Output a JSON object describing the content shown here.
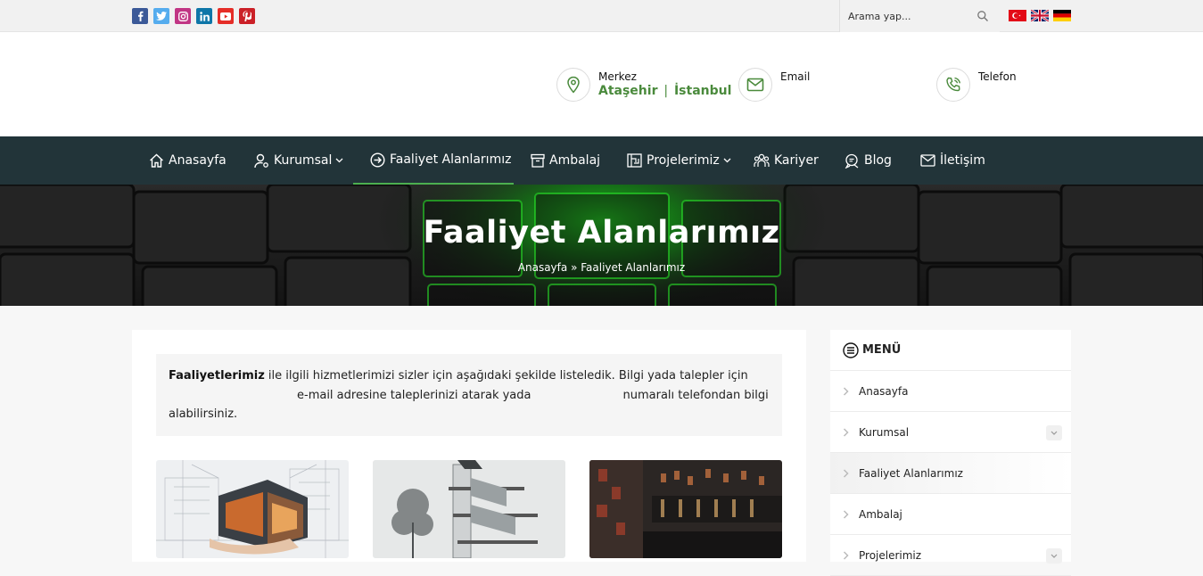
{
  "topbar": {
    "social": [
      {
        "name": "facebook",
        "glyph": "f",
        "color": "#3b5998"
      },
      {
        "name": "twitter",
        "glyph": "t",
        "color": "#55acee"
      },
      {
        "name": "instagram",
        "glyph": "◎",
        "color": "#c13584"
      },
      {
        "name": "linkedin",
        "glyph": "in",
        "color": "#0e76a8"
      },
      {
        "name": "youtube",
        "glyph": "▶",
        "color": "#e52d27"
      },
      {
        "name": "pinterest",
        "glyph": "P",
        "color": "#cb2027"
      }
    ],
    "search_placeholder": "Arama yap...",
    "flags": [
      "tr",
      "en",
      "de"
    ]
  },
  "header": {
    "contacts": [
      {
        "icon": "map-pin-icon",
        "label": "Merkez",
        "value_a": "Ataşehir",
        "separator": "|",
        "value_b": "İstanbul"
      },
      {
        "icon": "envelope-icon",
        "label": "Email",
        "value_a": "",
        "separator": "",
        "value_b": ""
      },
      {
        "icon": "phone-icon",
        "label": "Telefon",
        "value_a": "",
        "separator": "",
        "value_b": ""
      }
    ]
  },
  "nav": {
    "items": [
      {
        "label": "Anasayfa",
        "icon": "home-icon"
      },
      {
        "label": "Kurumsal",
        "icon": "user-gear-icon",
        "dropdown": true
      },
      {
        "label": "Faaliyet Alanlarımız",
        "icon": "arrow-circle-icon",
        "active": true
      },
      {
        "label": "Ambalaj",
        "icon": "box-icon"
      },
      {
        "label": "Projelerimiz",
        "icon": "blueprint-icon",
        "dropdown": true
      },
      {
        "label": "Kariyer",
        "icon": "team-icon"
      },
      {
        "label": "Blog",
        "icon": "chat-icon"
      },
      {
        "label": "İletişim",
        "icon": "envelope-icon"
      }
    ],
    "accent": "#4caf50",
    "background": "#223439"
  },
  "hero": {
    "title": "Faaliyet Alanlarımız",
    "breadcrumb_home": "Anasayfa",
    "breadcrumb_sep": "»",
    "breadcrumb_current": "Faaliyet Alanlarımız"
  },
  "intro": {
    "bold": "Faaliyetlerimiz",
    "line1": " ile ilgili hizmetlerimizi sizler için aşağıdaki şekilde listeledik. Bilgi yada talepler için",
    "line2a": "e-mail adresine taleplerinizi atarak yada",
    "line2b": "numaralı telefondan bilgi",
    "line3": "alabilirsiniz."
  },
  "sidebar": {
    "title": "MENÜ",
    "items": [
      {
        "label": "Anasayfa",
        "toggle": false
      },
      {
        "label": "Kurumsal",
        "toggle": true
      },
      {
        "label": "Faaliyet Alanlarımız",
        "toggle": false,
        "active": true
      },
      {
        "label": "Ambalaj",
        "toggle": false
      },
      {
        "label": "Projelerimiz",
        "toggle": true
      }
    ]
  },
  "thumbnails": [
    {
      "name": "architecture-house-image"
    },
    {
      "name": "building-section-image"
    },
    {
      "name": "interior-bar-image"
    }
  ]
}
